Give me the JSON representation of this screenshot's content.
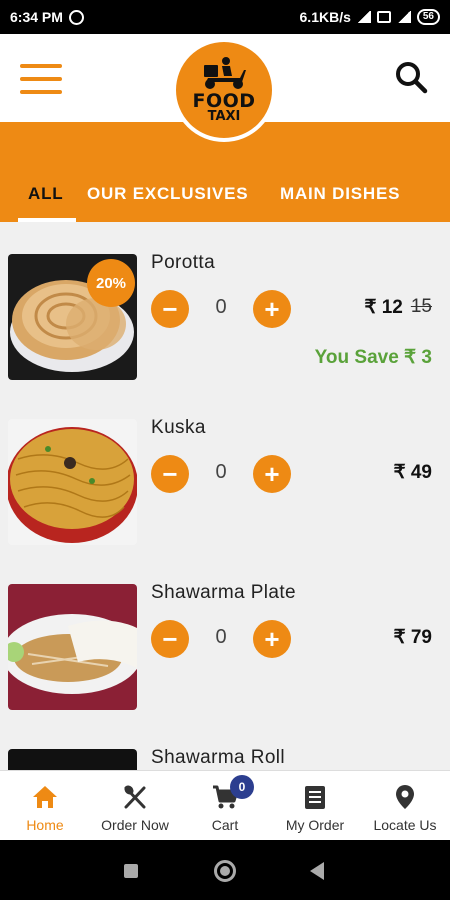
{
  "status_bar": {
    "time": "6:34 PM",
    "network_speed": "6.1KB/s",
    "battery": "56"
  },
  "header": {
    "logo_line1": "FOOD",
    "logo_line2": "TAXI"
  },
  "tabs": [
    {
      "label": "ALL",
      "active": true
    },
    {
      "label": "OUR EXCLUSIVES",
      "active": false
    },
    {
      "label": "MAIN DISHES",
      "active": false
    }
  ],
  "items": [
    {
      "name": "Porotta",
      "qty": "0",
      "price": "₹ 12",
      "old_price": "15",
      "discount": "20%",
      "save": "You Save ₹ 3"
    },
    {
      "name": "Kuska",
      "qty": "0",
      "price": "₹ 49"
    },
    {
      "name": "Shawarma Plate",
      "qty": "0",
      "price": "₹ 79"
    },
    {
      "name": "Shawarma Roll"
    }
  ],
  "bottom_nav": [
    {
      "label": "Home",
      "icon": "home-icon",
      "active": true
    },
    {
      "label": "Order Now",
      "icon": "fork-knife-icon"
    },
    {
      "label": "Cart",
      "icon": "cart-icon",
      "badge": "0"
    },
    {
      "label": "My Order",
      "icon": "list-icon"
    },
    {
      "label": "Locate Us",
      "icon": "location-pin-icon"
    }
  ],
  "colors": {
    "accent": "#ee8a14",
    "save_green": "#5aa23a",
    "badge": "#2c3e8f"
  }
}
